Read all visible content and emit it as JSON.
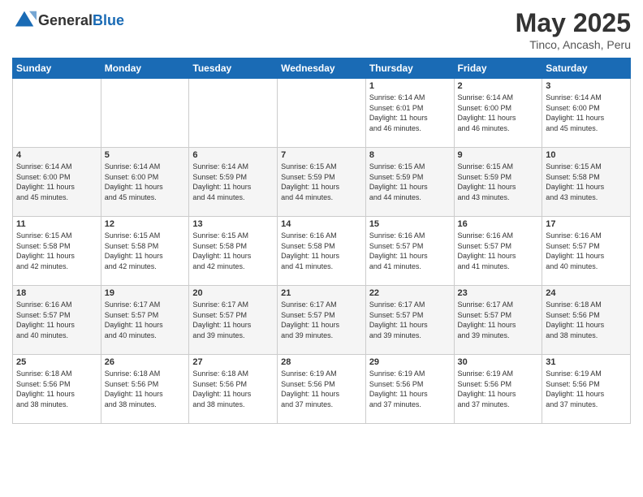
{
  "header": {
    "logo_general": "General",
    "logo_blue": "Blue",
    "month_title": "May 2025",
    "subtitle": "Tinco, Ancash, Peru"
  },
  "weekdays": [
    "Sunday",
    "Monday",
    "Tuesday",
    "Wednesday",
    "Thursday",
    "Friday",
    "Saturday"
  ],
  "weeks": [
    [
      {
        "day": "",
        "info": ""
      },
      {
        "day": "",
        "info": ""
      },
      {
        "day": "",
        "info": ""
      },
      {
        "day": "",
        "info": ""
      },
      {
        "day": "1",
        "info": "Sunrise: 6:14 AM\nSunset: 6:01 PM\nDaylight: 11 hours\nand 46 minutes."
      },
      {
        "day": "2",
        "info": "Sunrise: 6:14 AM\nSunset: 6:00 PM\nDaylight: 11 hours\nand 46 minutes."
      },
      {
        "day": "3",
        "info": "Sunrise: 6:14 AM\nSunset: 6:00 PM\nDaylight: 11 hours\nand 45 minutes."
      }
    ],
    [
      {
        "day": "4",
        "info": "Sunrise: 6:14 AM\nSunset: 6:00 PM\nDaylight: 11 hours\nand 45 minutes."
      },
      {
        "day": "5",
        "info": "Sunrise: 6:14 AM\nSunset: 6:00 PM\nDaylight: 11 hours\nand 45 minutes."
      },
      {
        "day": "6",
        "info": "Sunrise: 6:14 AM\nSunset: 5:59 PM\nDaylight: 11 hours\nand 44 minutes."
      },
      {
        "day": "7",
        "info": "Sunrise: 6:15 AM\nSunset: 5:59 PM\nDaylight: 11 hours\nand 44 minutes."
      },
      {
        "day": "8",
        "info": "Sunrise: 6:15 AM\nSunset: 5:59 PM\nDaylight: 11 hours\nand 44 minutes."
      },
      {
        "day": "9",
        "info": "Sunrise: 6:15 AM\nSunset: 5:59 PM\nDaylight: 11 hours\nand 43 minutes."
      },
      {
        "day": "10",
        "info": "Sunrise: 6:15 AM\nSunset: 5:58 PM\nDaylight: 11 hours\nand 43 minutes."
      }
    ],
    [
      {
        "day": "11",
        "info": "Sunrise: 6:15 AM\nSunset: 5:58 PM\nDaylight: 11 hours\nand 42 minutes."
      },
      {
        "day": "12",
        "info": "Sunrise: 6:15 AM\nSunset: 5:58 PM\nDaylight: 11 hours\nand 42 minutes."
      },
      {
        "day": "13",
        "info": "Sunrise: 6:15 AM\nSunset: 5:58 PM\nDaylight: 11 hours\nand 42 minutes."
      },
      {
        "day": "14",
        "info": "Sunrise: 6:16 AM\nSunset: 5:58 PM\nDaylight: 11 hours\nand 41 minutes."
      },
      {
        "day": "15",
        "info": "Sunrise: 6:16 AM\nSunset: 5:57 PM\nDaylight: 11 hours\nand 41 minutes."
      },
      {
        "day": "16",
        "info": "Sunrise: 6:16 AM\nSunset: 5:57 PM\nDaylight: 11 hours\nand 41 minutes."
      },
      {
        "day": "17",
        "info": "Sunrise: 6:16 AM\nSunset: 5:57 PM\nDaylight: 11 hours\nand 40 minutes."
      }
    ],
    [
      {
        "day": "18",
        "info": "Sunrise: 6:16 AM\nSunset: 5:57 PM\nDaylight: 11 hours\nand 40 minutes."
      },
      {
        "day": "19",
        "info": "Sunrise: 6:17 AM\nSunset: 5:57 PM\nDaylight: 11 hours\nand 40 minutes."
      },
      {
        "day": "20",
        "info": "Sunrise: 6:17 AM\nSunset: 5:57 PM\nDaylight: 11 hours\nand 39 minutes."
      },
      {
        "day": "21",
        "info": "Sunrise: 6:17 AM\nSunset: 5:57 PM\nDaylight: 11 hours\nand 39 minutes."
      },
      {
        "day": "22",
        "info": "Sunrise: 6:17 AM\nSunset: 5:57 PM\nDaylight: 11 hours\nand 39 minutes."
      },
      {
        "day": "23",
        "info": "Sunrise: 6:17 AM\nSunset: 5:57 PM\nDaylight: 11 hours\nand 39 minutes."
      },
      {
        "day": "24",
        "info": "Sunrise: 6:18 AM\nSunset: 5:56 PM\nDaylight: 11 hours\nand 38 minutes."
      }
    ],
    [
      {
        "day": "25",
        "info": "Sunrise: 6:18 AM\nSunset: 5:56 PM\nDaylight: 11 hours\nand 38 minutes."
      },
      {
        "day": "26",
        "info": "Sunrise: 6:18 AM\nSunset: 5:56 PM\nDaylight: 11 hours\nand 38 minutes."
      },
      {
        "day": "27",
        "info": "Sunrise: 6:18 AM\nSunset: 5:56 PM\nDaylight: 11 hours\nand 38 minutes."
      },
      {
        "day": "28",
        "info": "Sunrise: 6:19 AM\nSunset: 5:56 PM\nDaylight: 11 hours\nand 37 minutes."
      },
      {
        "day": "29",
        "info": "Sunrise: 6:19 AM\nSunset: 5:56 PM\nDaylight: 11 hours\nand 37 minutes."
      },
      {
        "day": "30",
        "info": "Sunrise: 6:19 AM\nSunset: 5:56 PM\nDaylight: 11 hours\nand 37 minutes."
      },
      {
        "day": "31",
        "info": "Sunrise: 6:19 AM\nSunset: 5:56 PM\nDaylight: 11 hours\nand 37 minutes."
      }
    ]
  ]
}
